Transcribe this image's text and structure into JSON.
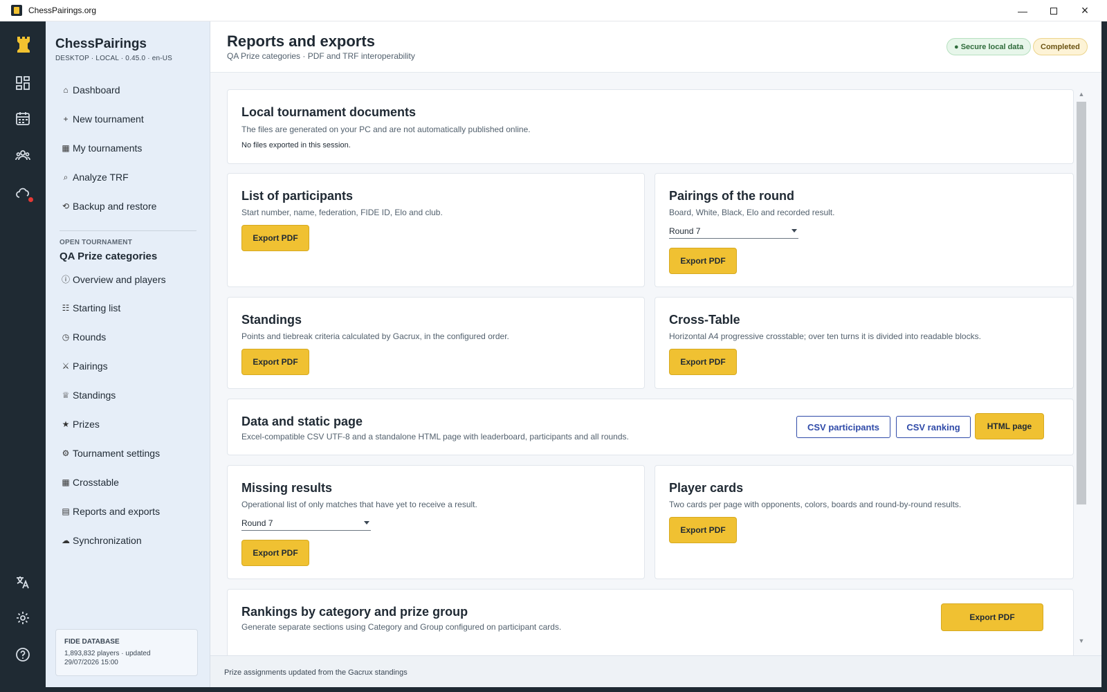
{
  "window": {
    "title": "ChessPairings.org"
  },
  "sidebar": {
    "brand": "ChessPairings",
    "brand_sub": "DESKTOP · LOCAL · 0.45.0 · en-US",
    "main_nav": [
      {
        "icon": "⌂",
        "label": "Dashboard"
      },
      {
        "icon": "+",
        "label": "New tournament"
      },
      {
        "icon": "▦",
        "label": "My tournaments"
      },
      {
        "icon": "⌕",
        "label": "Analyze TRF"
      },
      {
        "icon": "⟲",
        "label": "Backup and restore"
      }
    ],
    "section_label": "OPEN TOURNAMENT",
    "tournament_name": "QA Prize categories",
    "tournament_nav": [
      {
        "icon": "ⓘ",
        "label": "Overview and players"
      },
      {
        "icon": "☷",
        "label": "Starting list"
      },
      {
        "icon": "◷",
        "label": "Rounds"
      },
      {
        "icon": "⚔",
        "label": "Pairings"
      },
      {
        "icon": "♕",
        "label": "Standings"
      },
      {
        "icon": "★",
        "label": "Prizes"
      },
      {
        "icon": "⚙",
        "label": "Tournament settings"
      },
      {
        "icon": "▦",
        "label": "Crosstable"
      },
      {
        "icon": "▤",
        "label": "Reports and exports"
      },
      {
        "icon": "☁",
        "label": "Synchronization"
      }
    ],
    "fide": {
      "label": "FIDE DATABASE",
      "info": "1,893,832 players · updated 29/07/2026 15:00"
    }
  },
  "header": {
    "title": "Reports and exports",
    "subtitle": "QA Prize categories · PDF and TRF interoperability",
    "badge_secure": "● Secure local data",
    "badge_status": "Completed"
  },
  "cards": {
    "local": {
      "title": "Local tournament documents",
      "desc": "The files are generated on your PC and are not automatically published online.",
      "note": "No files exported in this session."
    },
    "participants": {
      "title": "List of participants",
      "desc": "Start number, name, federation, FIDE ID, Elo and club.",
      "button": "Export PDF"
    },
    "pairings": {
      "title": "Pairings of the round",
      "desc": "Board, White, Black, Elo and recorded result.",
      "select": "Round 7",
      "button": "Export PDF"
    },
    "standings": {
      "title": "Standings",
      "desc": "Points and tiebreak criteria calculated by Gacrux, in the configured order.",
      "button": "Export PDF"
    },
    "crosstable": {
      "title": "Cross-Table",
      "desc": "Horizontal A4 progressive crosstable; over ten turns it is divided into readable blocks.",
      "button": "Export PDF"
    },
    "data": {
      "title": "Data and static page",
      "desc": "Excel-compatible CSV UTF-8 and a standalone HTML page with leaderboard, participants and all rounds.",
      "btn_csv_participants": "CSV participants",
      "btn_csv_ranking": "CSV ranking",
      "btn_html": "HTML page"
    },
    "missing": {
      "title": "Missing results",
      "desc": "Operational list of only matches that have yet to receive a result.",
      "select": "Round 7",
      "button": "Export PDF"
    },
    "player_cards": {
      "title": "Player cards",
      "desc": "Two cards per page with opponents, colors, boards and round-by-round results.",
      "button": "Export PDF"
    },
    "rankings": {
      "title": "Rankings by category and prize group",
      "desc": "Generate separate sections using Category and Group configured on participant cards.",
      "button": "Export PDF"
    }
  },
  "footer": {
    "message": "Prize assignments updated from the Gacrux standings"
  },
  "colors": {
    "accent": "#f0c132",
    "rail": "#1f2a33",
    "sidebar": "#e6eef8",
    "link": "#2f4aa8"
  }
}
